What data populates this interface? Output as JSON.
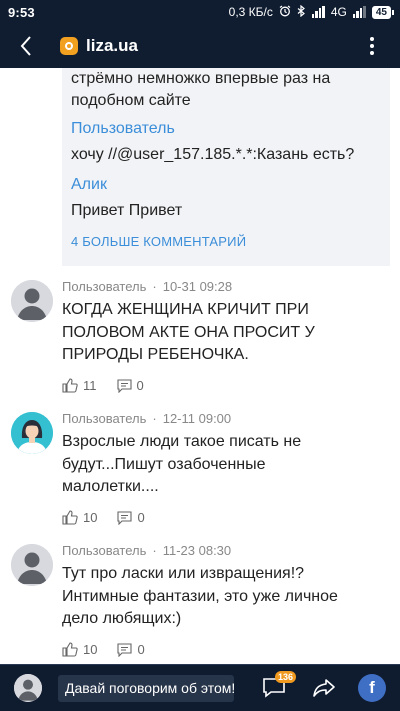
{
  "status_bar": {
    "time": "9:53",
    "speed": "0,3 КБ/с",
    "network": "4G",
    "battery": "45"
  },
  "app_bar": {
    "title": "liza.ua"
  },
  "replies": {
    "items": [
      {
        "author": "",
        "text_lines": [
          "стрёмно немножко впервые раз на",
          "подобном сайте"
        ]
      },
      {
        "author": "Пользователь",
        "text_lines": [
          "хочу //@user_157.185.*.*:Казань есть?"
        ]
      },
      {
        "author": "Алик",
        "text_lines": [
          "Привет Привет"
        ]
      }
    ],
    "more_label": "4 БОЛЬШЕ КОММЕНТАРИЙ"
  },
  "comments": [
    {
      "author": "Пользователь",
      "date": "10-31 09:28",
      "text_lines": [
        "КОГДА ЖЕНЩИНА КРИЧИТ ПРИ",
        "ПОЛОВОМ АКТЕ ОНА ПРОСИТ У",
        "ПРИРОДЫ РЕБЕНОЧКА."
      ],
      "likes": "11",
      "replies": "0",
      "avatar": "default-avatar"
    },
    {
      "author": "Пользователь",
      "date": "12-11 09:00",
      "text_lines": [
        "Взрослые люди такое писать не",
        "будут...Пишут озабоченные",
        "малолетки...."
      ],
      "likes": "10",
      "replies": "0",
      "avatar": "female-avatar"
    },
    {
      "author": "Пользователь",
      "date": "11-23 08:30",
      "text_lines": [
        "Тут про ласки или извращения!?",
        "Интимные фантазии, это уже личное",
        "дело любящих:)"
      ],
      "likes": "10",
      "replies": "0",
      "avatar": "default-avatar"
    }
  ],
  "bottom_bar": {
    "input_placeholder": "Давай поговорим об этом!",
    "comment_count": "136",
    "facebook_label": "f"
  },
  "colors": {
    "header_bg": "#101d31",
    "link_blue": "#3b8ed9",
    "badge_orange": "#f09a1f",
    "facebook_blue": "#3f6fc4"
  }
}
